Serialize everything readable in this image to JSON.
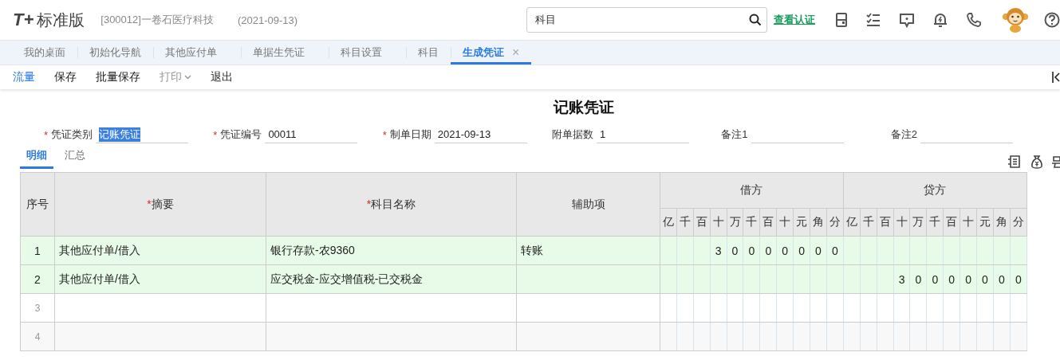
{
  "app": {
    "logo": "T+",
    "edition": "标准版",
    "company": "[300012]一卷石医疗科技",
    "date": "(2021-09-13)"
  },
  "search": {
    "value": "科目"
  },
  "header_link": "查看认证",
  "nav_tabs": [
    {
      "label": "我的桌面",
      "selected": false
    },
    {
      "label": "初始化导航",
      "selected": false
    },
    {
      "label": "其他应付单",
      "selected": false
    },
    {
      "label": "单据生凭证",
      "selected": false
    },
    {
      "label": "科目设置",
      "selected": false
    },
    {
      "label": "科目",
      "selected": false
    },
    {
      "label": "生成凭证",
      "selected": true,
      "close": "×"
    }
  ],
  "toolbar": [
    {
      "label": "流量",
      "kind": "link",
      "disabled": false
    },
    {
      "label": "保存",
      "kind": "button",
      "disabled": false
    },
    {
      "label": "批量保存",
      "kind": "button",
      "disabled": false
    },
    {
      "label": "打印",
      "kind": "dropdown",
      "disabled": true
    },
    {
      "label": "退出",
      "kind": "button",
      "disabled": false
    }
  ],
  "voucher": {
    "title": "记账凭证",
    "fields": [
      {
        "required_mark": "*",
        "label": "凭证类别",
        "value": "记账凭证",
        "highlighted": true
      },
      {
        "required_mark": "*",
        "label": "凭证编号",
        "value": "00011",
        "highlighted": false
      },
      {
        "required_mark": "*",
        "label": "制单日期",
        "value": "2021-09-13",
        "highlighted": false
      },
      {
        "label": "附单据数",
        "value": "1",
        "highlighted": false
      },
      {
        "label": "备注1"
      },
      {
        "label": "备注2"
      }
    ]
  },
  "detail_tabs": [
    {
      "label": "明细",
      "selected": true
    },
    {
      "label": "汇总",
      "selected": false
    }
  ],
  "table": {
    "columns": [
      {
        "label": "序号"
      },
      {
        "required_mark": "*",
        "label": "摘要"
      },
      {
        "required_mark": "*",
        "label": "科目名称"
      },
      {
        "label": "辅助项"
      }
    ],
    "amount_groups": [
      {
        "label": "借方",
        "units": [
          "亿",
          "千",
          "百",
          "十",
          "万",
          "千",
          "百",
          "十",
          "元",
          "角",
          "分"
        ]
      },
      {
        "label": "贷方",
        "units": [
          "亿",
          "千",
          "百",
          "十",
          "万",
          "千",
          "百",
          "十",
          "元",
          "角",
          "分"
        ]
      }
    ],
    "rows": [
      {
        "no": "1",
        "summary": "其他应付单/借入",
        "account": "银行存款-农9360",
        "aux": "转账",
        "debit": [
          "3",
          "0",
          "0",
          "0",
          "0",
          "0",
          "0",
          "0"
        ],
        "highlighted": true
      },
      {
        "no": "2",
        "summary": "其他应付单/借入",
        "account": "应交税金-应交增值税-已交税金",
        "credit": [
          "3",
          "0",
          "0",
          "0",
          "0",
          "0",
          "0",
          "0"
        ],
        "highlighted": true
      },
      {
        "no": "3",
        "highlighted": false
      },
      {
        "no": "4",
        "highlighted": false
      }
    ]
  }
}
